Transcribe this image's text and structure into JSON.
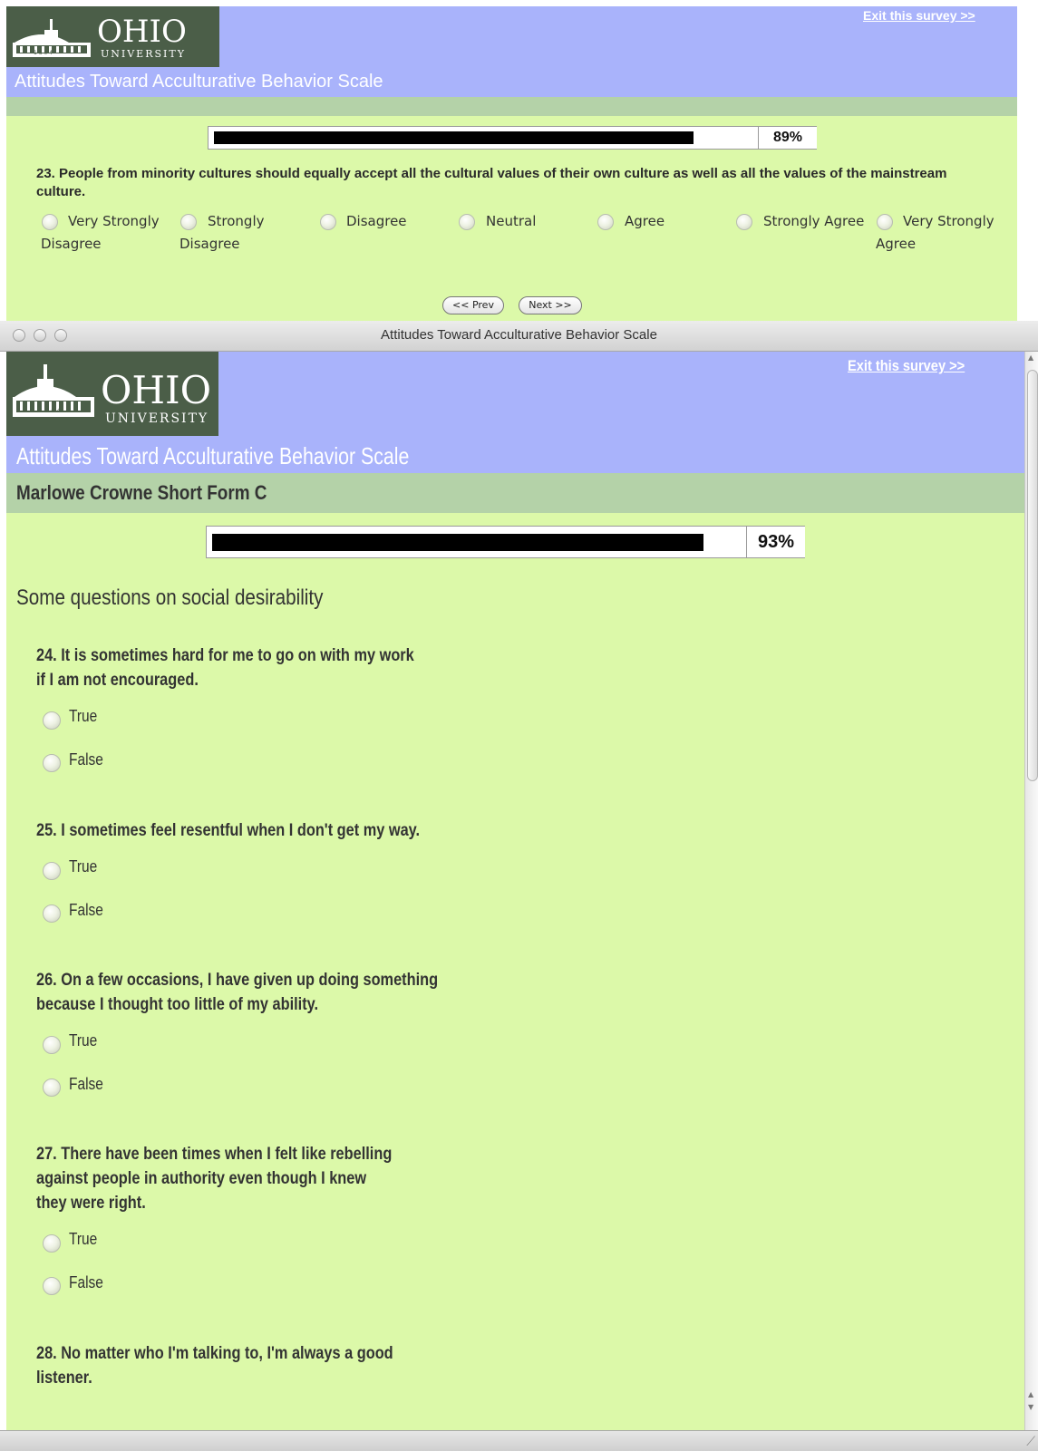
{
  "top_page": {
    "logo": {
      "name": "OHIO",
      "sub": "UNIVERSITY",
      "year": "1 8 0 4"
    },
    "exit_link": "Exit this survey >>",
    "survey_title": "Attitudes Toward Acculturative Behavior Scale",
    "progress": {
      "percent_label": "89%",
      "value": 0.89
    },
    "question": {
      "text": "23. People from minority cultures should equally accept all the cultural values of their own culture as well as all the values of the mainstream culture.",
      "options": [
        {
          "line1": "Very Strongly",
          "line2": "Disagree"
        },
        {
          "line1": "Strongly",
          "line2": "Disagree"
        },
        {
          "line1": "Disagree",
          "line2": ""
        },
        {
          "line1": "Neutral",
          "line2": ""
        },
        {
          "line1": "Agree",
          "line2": ""
        },
        {
          "line1": "Strongly Agree",
          "line2": ""
        },
        {
          "line1": "Very Strongly",
          "line2": "Agree"
        }
      ]
    },
    "buttons": {
      "prev": "<< Prev",
      "next": "Next >>"
    }
  },
  "window": {
    "title": "Attitudes Toward Acculturative Behavior Scale"
  },
  "second_page": {
    "logo": {
      "name": "OHIO",
      "sub": "UNIVERSITY",
      "year": "1 8 0 4"
    },
    "exit_link": "Exit this survey >>",
    "survey_title": "Attitudes Toward Acculturative Behavior Scale",
    "section_title": "Marlowe Crowne Short Form C",
    "progress": {
      "percent_label": "93%",
      "value": 0.93
    },
    "intro": "Some questions on social desirability",
    "questions": [
      {
        "line1": "24. It is sometimes hard for me to go on with my work",
        "line2": "if I am not encouraged.",
        "line3": "",
        "opt_true": "True",
        "opt_false": "False"
      },
      {
        "line1": "25. I sometimes feel resentful when I don't get my way.",
        "line2": "",
        "line3": "",
        "opt_true": "True",
        "opt_false": "False"
      },
      {
        "line1": "26. On a few occasions, I have given up doing something",
        "line2": "because I thought too little of my ability.",
        "line3": "",
        "opt_true": "True",
        "opt_false": "False"
      },
      {
        "line1": "27. There have been times when I felt like rebelling",
        "line2": "against people in authority even though I knew",
        "line3": "they were right.",
        "opt_true": "True",
        "opt_false": "False"
      },
      {
        "line1": "28. No matter who I'm talking to, I'm always a good",
        "line2": "listener.",
        "line3": ""
      }
    ]
  }
}
